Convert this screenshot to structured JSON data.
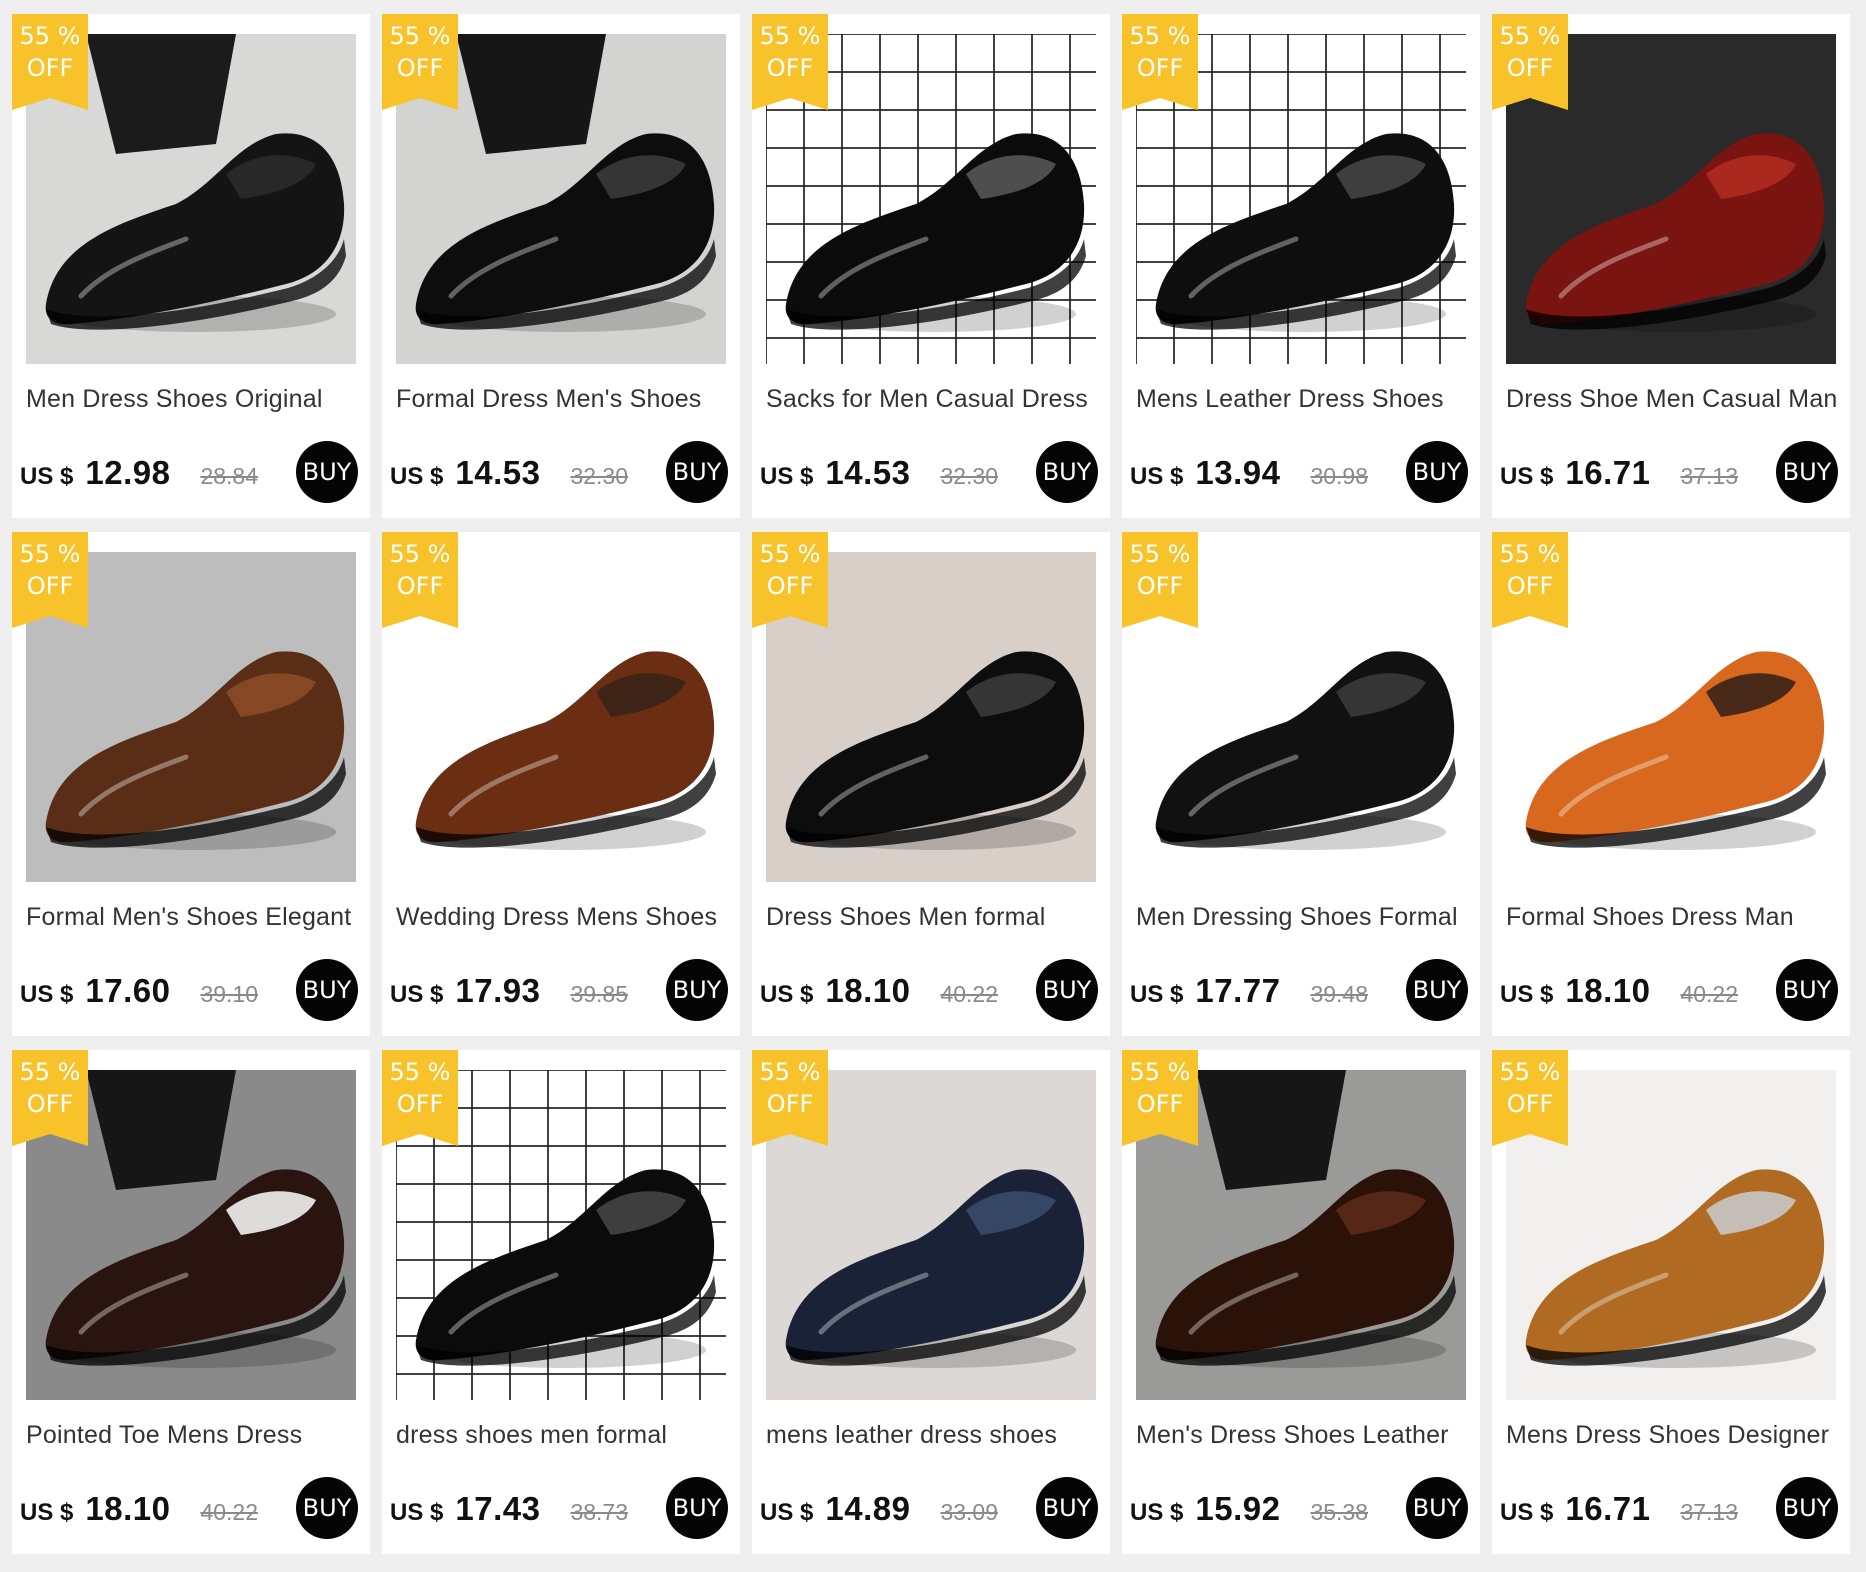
{
  "products": [
    {
      "title": "Men Dress Shoes Original",
      "currency": "US $",
      "price": "12.98",
      "old_price": "28.84",
      "discount_pct": "55 %",
      "discount_off": "OFF",
      "buy": "BUY",
      "scene": {
        "bg": "#d8d8d6",
        "shoe": "#141414",
        "accent": "#2a2a2a",
        "pants": "#1b1b1b",
        "grid": false
      }
    },
    {
      "title": "Formal Dress Men's Shoes",
      "currency": "US $",
      "price": "14.53",
      "old_price": "32.30",
      "discount_pct": "55 %",
      "discount_off": "OFF",
      "buy": "BUY",
      "scene": {
        "bg": "#d3d3d1",
        "shoe": "#0d0d0d",
        "accent": "#3a3a3a",
        "pants": "#161616",
        "grid": false
      }
    },
    {
      "title": "Sacks for Men Casual Dress",
      "currency": "US $",
      "price": "14.53",
      "old_price": "32.30",
      "discount_pct": "55 %",
      "discount_off": "OFF",
      "buy": "BUY",
      "scene": {
        "bg": "#ffffff",
        "shoe": "#0b0b0b",
        "accent": "#555555",
        "pants": "",
        "grid": true
      }
    },
    {
      "title": "Mens Leather Dress Shoes",
      "currency": "US $",
      "price": "13.94",
      "old_price": "30.98",
      "discount_pct": "55 %",
      "discount_off": "OFF",
      "buy": "BUY",
      "scene": {
        "bg": "#ffffff",
        "shoe": "#0e0e0e",
        "accent": "#444444",
        "pants": "",
        "grid": true
      }
    },
    {
      "title": "Dress Shoe Men Casual Man",
      "currency": "US $",
      "price": "16.71",
      "old_price": "37.13",
      "discount_pct": "55 %",
      "discount_off": "OFF",
      "buy": "BUY",
      "scene": {
        "bg": "#2a2a2a",
        "shoe": "#7a1410",
        "accent": "#b02a20",
        "pants": "",
        "grid": false
      }
    },
    {
      "title": "Formal Men's Shoes Elegant",
      "currency": "US $",
      "price": "17.60",
      "old_price": "39.10",
      "discount_pct": "55 %",
      "discount_off": "OFF",
      "buy": "BUY",
      "scene": {
        "bg": "#bdbdbd",
        "shoe": "#5a2e16",
        "accent": "#8a4a26",
        "pants": "",
        "grid": false
      }
    },
    {
      "title": "Wedding Dress Mens Shoes",
      "currency": "US $",
      "price": "17.93",
      "old_price": "39.85",
      "discount_pct": "55 %",
      "discount_off": "OFF",
      "buy": "BUY",
      "scene": {
        "bg": "#ffffff",
        "shoe": "#6b2e12",
        "accent": "#3a2418",
        "pants": "",
        "grid": false
      }
    },
    {
      "title": "Dress Shoes Men    formal",
      "currency": "US $",
      "price": "18.10",
      "old_price": "40.22",
      "discount_pct": "55 %",
      "discount_off": "OFF",
      "buy": "BUY",
      "scene": {
        "bg": "#d8cfc8",
        "shoe": "#0d0d0d",
        "accent": "#3a3a3a",
        "pants": "",
        "grid": false
      }
    },
    {
      "title": "Men Dressing Shoes Formal",
      "currency": "US $",
      "price": "17.77",
      "old_price": "39.48",
      "discount_pct": "55 %",
      "discount_off": "OFF",
      "buy": "BUY",
      "scene": {
        "bg": "#ffffff",
        "shoe": "#111111",
        "accent": "#3a3a3a",
        "pants": "",
        "grid": false
      }
    },
    {
      "title": "Formal Shoes Dress Man",
      "currency": "US $",
      "price": "18.10",
      "old_price": "40.22",
      "discount_pct": "55 %",
      "discount_off": "OFF",
      "buy": "BUY",
      "scene": {
        "bg": "#ffffff",
        "shoe": "#d8681e",
        "accent": "#3a2418",
        "pants": "",
        "grid": false
      }
    },
    {
      "title": "Pointed Toe Mens Dress",
      "currency": "US $",
      "price": "18.10",
      "old_price": "40.22",
      "discount_pct": "55 %",
      "discount_off": "OFF",
      "buy": "BUY",
      "scene": {
        "bg": "#8a8a8a",
        "shoe": "#2a1410",
        "accent": "#f2f2f2",
        "pants": "#161616",
        "grid": false
      }
    },
    {
      "title": "dress shoes men formal",
      "currency": "US $",
      "price": "17.43",
      "old_price": "38.73",
      "discount_pct": "55 %",
      "discount_off": "OFF",
      "buy": "BUY",
      "scene": {
        "bg": "#ffffff",
        "shoe": "#0b0b0b",
        "accent": "#444444",
        "pants": "",
        "grid": true
      }
    },
    {
      "title": "mens leather dress shoes",
      "currency": "US $",
      "price": "14.89",
      "old_price": "33.09",
      "discount_pct": "55 %",
      "discount_off": "OFF",
      "buy": "BUY",
      "scene": {
        "bg": "#dcd8d6",
        "shoe": "#1a2238",
        "accent": "#3a4a6a",
        "pants": "",
        "grid": false
      }
    },
    {
      "title": "Men's Dress Shoes Leather",
      "currency": "US $",
      "price": "15.92",
      "old_price": "35.38",
      "discount_pct": "55 %",
      "discount_off": "OFF",
      "buy": "BUY",
      "scene": {
        "bg": "#9a9a98",
        "shoe": "#2a1208",
        "accent": "#5a2a18",
        "pants": "#161616",
        "grid": false
      }
    },
    {
      "title": "Mens Dress Shoes Designer",
      "currency": "US $",
      "price": "16.71",
      "old_price": "37.13",
      "discount_pct": "55 %",
      "discount_off": "OFF",
      "buy": "BUY",
      "scene": {
        "bg": "#f2f0ee",
        "shoe": "#b06a22",
        "accent": "#c8c8c8",
        "pants": "",
        "grid": false
      }
    }
  ]
}
